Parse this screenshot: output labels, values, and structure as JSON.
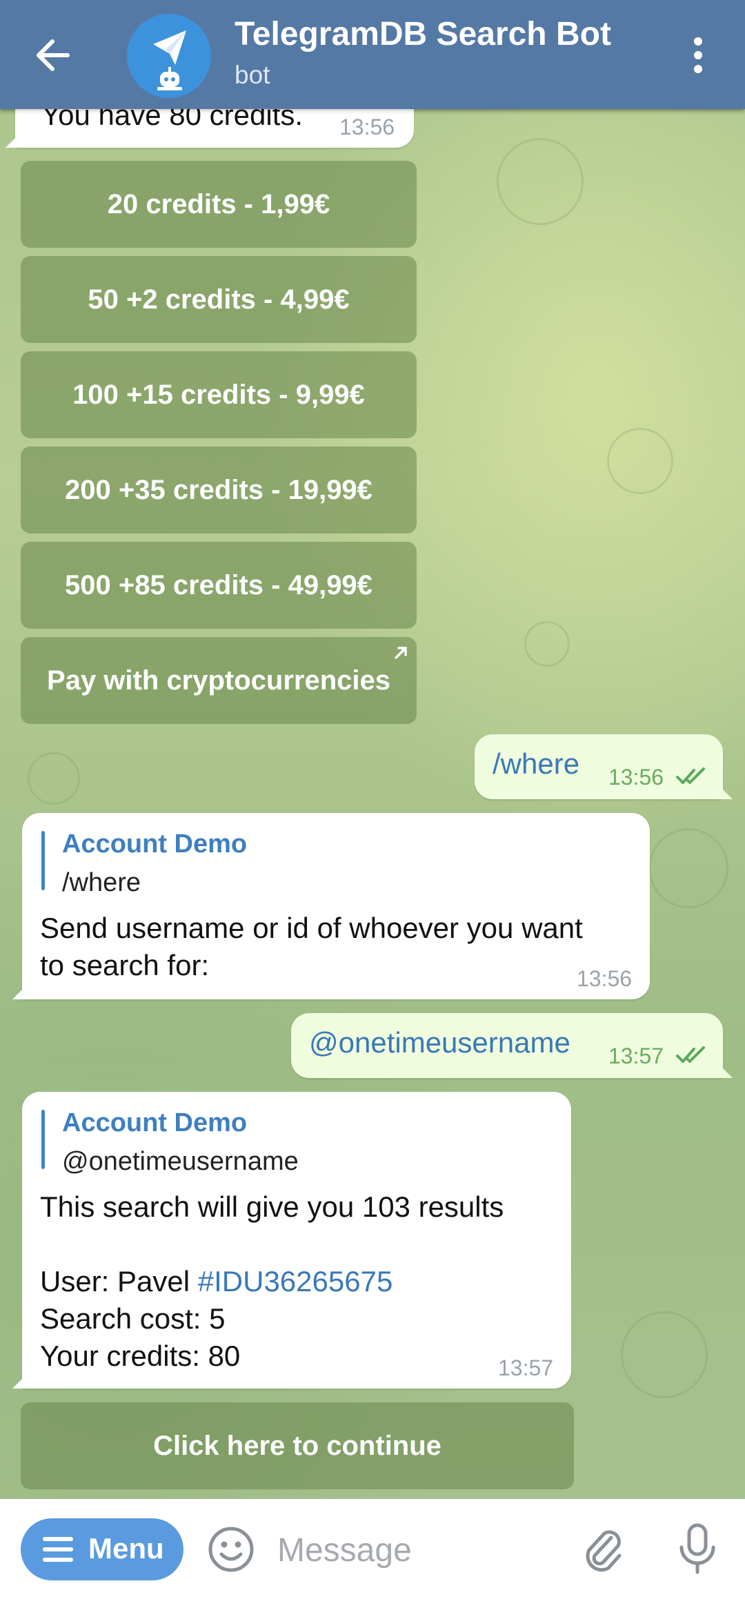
{
  "header": {
    "title": "TelegramDB Search Bot",
    "subtitle": "bot"
  },
  "credits_message": {
    "text": "You have 80 credits.",
    "time": "13:56"
  },
  "purchase_buttons": [
    "20  credits - 1,99€",
    "50  +2 credits - 4,99€",
    "100  +15 credits - 9,99€",
    "200  +35 credits - 19,99€",
    "500  +85 credits - 49,99€",
    "Pay with cryptocurrencies"
  ],
  "sent_where": {
    "text": "/where",
    "time": "13:56"
  },
  "bot_reply_where": {
    "reply_author": "Account Demo",
    "reply_text": "/where",
    "line1": "Send username or id of whoever you want",
    "line2": "to search for:",
    "time": "13:56"
  },
  "sent_username": {
    "text": "@onetimeusername",
    "time": "13:57"
  },
  "bot_reply_search": {
    "reply_author": "Account Demo",
    "reply_text": "@onetimeusername",
    "line1": "This search will give you 103 results",
    "user_label": "User: Pavel ",
    "user_tag": "#IDU36265675",
    "cost": "Search cost: 5",
    "credits": "Your credits: 80",
    "time": "13:57"
  },
  "continue_button": "Click here to continue",
  "input_bar": {
    "menu_label": "Menu",
    "placeholder": "Message"
  },
  "colors": {
    "header": "#5579a5",
    "accent": "#5a9be0",
    "link": "#3e7fc0",
    "outgoing_bubble": "#effdde"
  }
}
